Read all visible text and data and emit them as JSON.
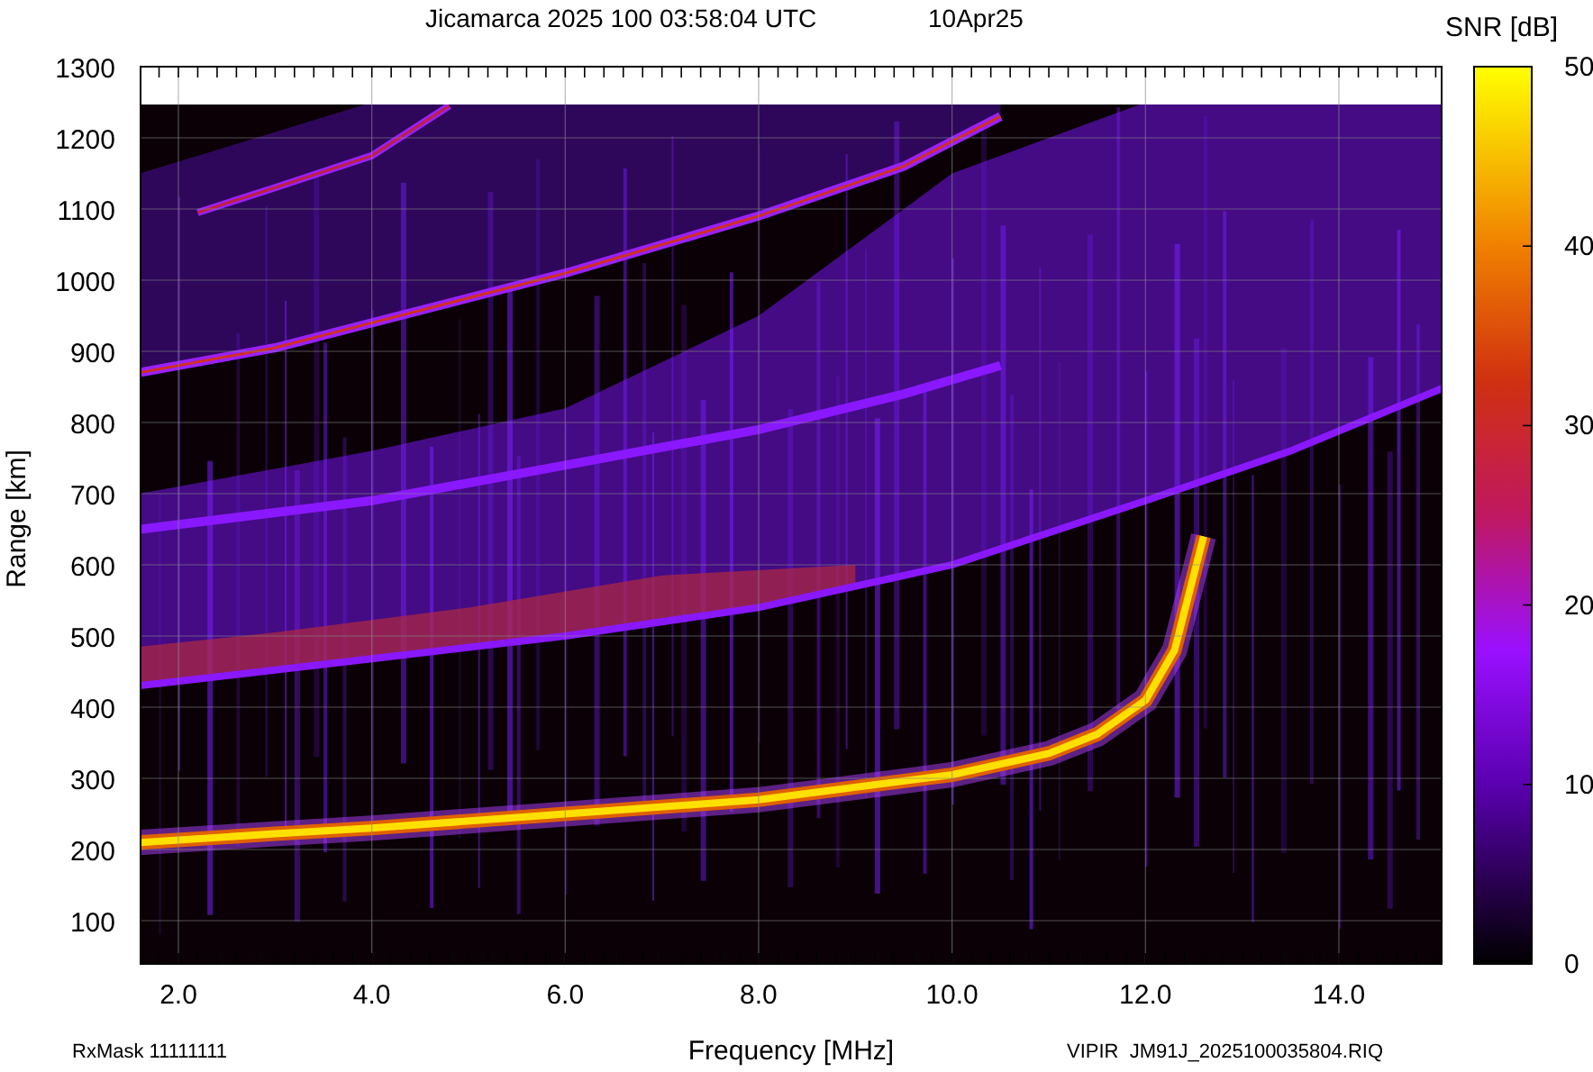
{
  "title": "Jicamarca 2025 100 03:58:04 UTC",
  "date": "10Apr25",
  "plot": {
    "xlabel": "Frequency [MHz]",
    "ylabel": "Range [km]",
    "xticks": [
      "2.0",
      "4.0",
      "6.0",
      "8.0",
      "10.0",
      "12.0",
      "14.0"
    ],
    "yticks": [
      "1300",
      "1200",
      "1100",
      "1000",
      "900",
      "800",
      "700",
      "600",
      "500",
      "400",
      "300",
      "200",
      "100"
    ]
  },
  "colorbar": {
    "title": "SNR [dB]",
    "ticks": [
      "50",
      "40",
      "30",
      "20",
      "10",
      "0"
    ]
  },
  "footer": {
    "rx_mask": "RxMask 11111111",
    "file": "VIPIR  JM91J_2025100035804.RIQ"
  }
}
